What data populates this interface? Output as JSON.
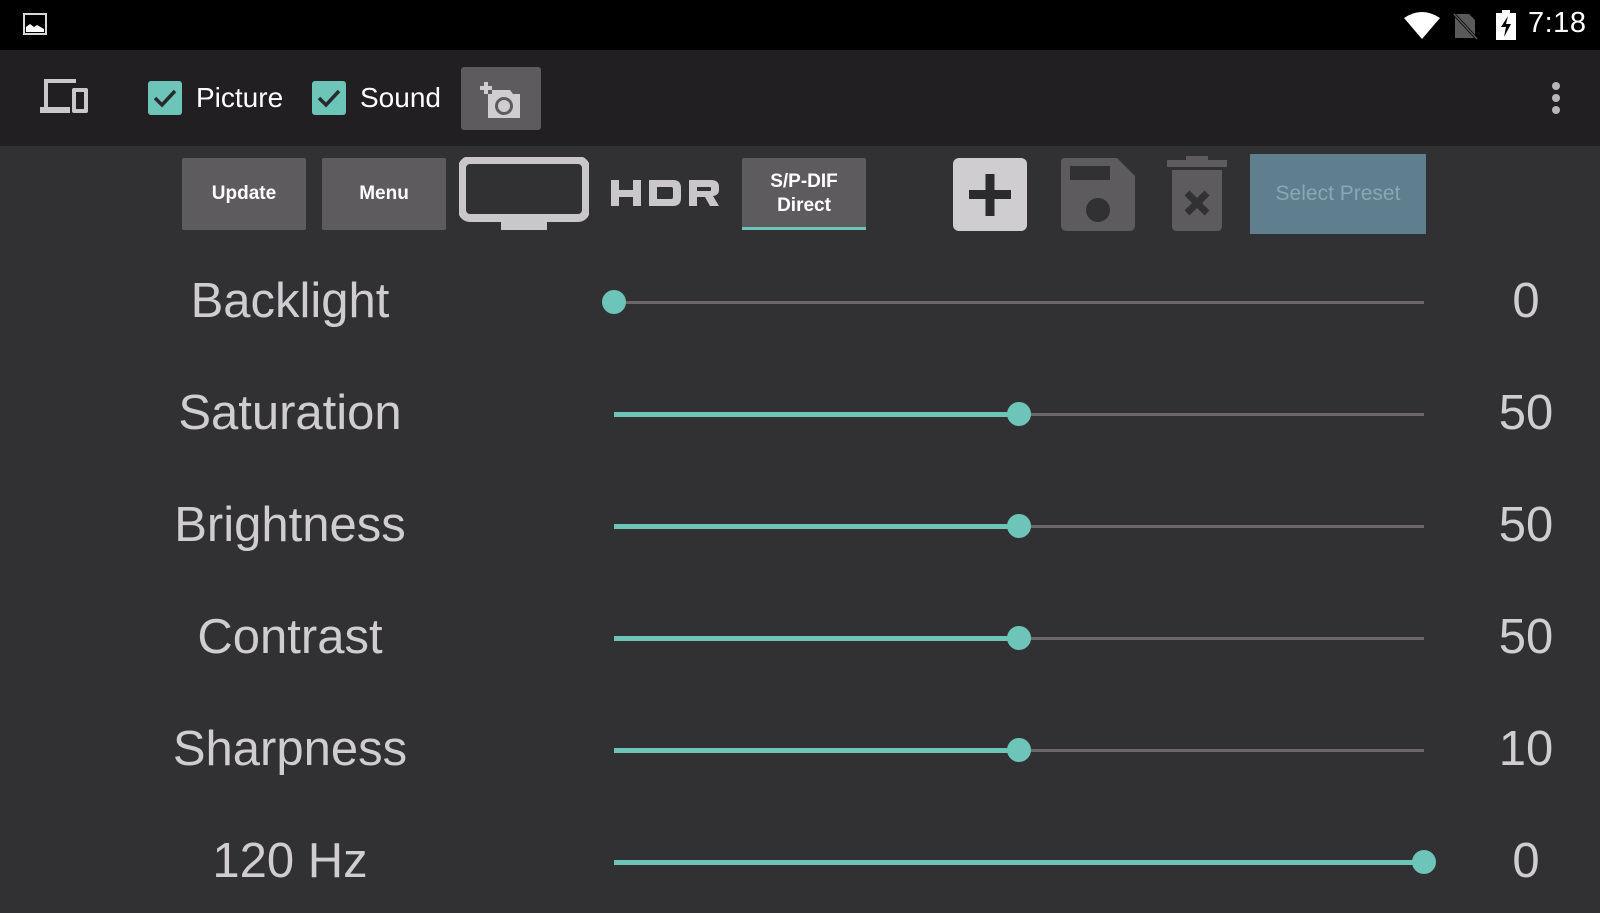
{
  "status_bar": {
    "time": "7:18",
    "icons": [
      "gallery-notification-icon",
      "wifi-icon",
      "no-sim-icon",
      "battery-charging-icon"
    ]
  },
  "action_bar": {
    "devices_icon": "devices-icon",
    "checkboxes": [
      {
        "label": "Picture",
        "checked": true
      },
      {
        "label": "Sound",
        "checked": true
      }
    ],
    "screenshot_button_icon": "add-camera-icon",
    "overflow_icon": "more-vert-icon"
  },
  "toolbar": {
    "update_label": "Update",
    "menu_label": "Menu",
    "tv_icon": "tv-icon",
    "hdr_label": "HDR",
    "spdif_line1": "S/P-DIF",
    "spdif_line2": "Direct",
    "add_icon": "add-preset-icon",
    "save_icon": "save-icon",
    "delete_icon": "delete-icon",
    "preset_placeholder": "Select Preset"
  },
  "colors": {
    "accent": "#6cc5b8",
    "background": "#313033",
    "action_bar": "#211f22",
    "button": "#5d5b5e",
    "preset_button": "#5f7f8e",
    "text": "#cfcdd0"
  },
  "settings": [
    {
      "label": "Backlight",
      "value": "0",
      "slider_fraction": 0.0
    },
    {
      "label": "Saturation",
      "value": "50",
      "slider_fraction": 0.5
    },
    {
      "label": "Brightness",
      "value": "50",
      "slider_fraction": 0.5
    },
    {
      "label": "Contrast",
      "value": "50",
      "slider_fraction": 0.5
    },
    {
      "label": "Sharpness",
      "value": "10",
      "slider_fraction": 0.5
    },
    {
      "label": "120 Hz",
      "value": "0",
      "slider_fraction": 1.0
    }
  ]
}
